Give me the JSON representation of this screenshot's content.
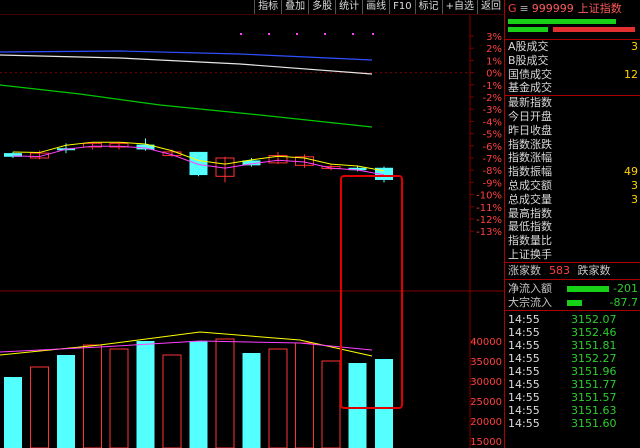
{
  "toolbar": [
    {
      "label": "指标",
      "name": "toolbar-indicator-button"
    },
    {
      "label": "叠加",
      "name": "toolbar-overlay-button"
    },
    {
      "label": "多股",
      "name": "toolbar-multistock-button"
    },
    {
      "label": "统计",
      "name": "toolbar-statistics-button"
    },
    {
      "label": "画线",
      "name": "toolbar-drawline-button"
    },
    {
      "label": "F10",
      "name": "toolbar-f10-button"
    },
    {
      "label": "标记",
      "name": "toolbar-mark-button"
    },
    {
      "label": "+自选",
      "name": "toolbar-add-watchlist-button"
    },
    {
      "label": "返回",
      "name": "toolbar-back-button"
    }
  ],
  "header": {
    "group": "G",
    "eq": "≡",
    "code": "999999",
    "name": "上证指数"
  },
  "colors": {
    "up": "#ff3232",
    "down": "#54ffff",
    "ma_white": "#e6e6e6",
    "ma_yellow": "#ffff00",
    "ma_magenta": "#ff40ff",
    "ma_green": "#00c800",
    "grid": "#800000",
    "highlight": "#e00000"
  },
  "price_axis": [
    "3%",
    "2%",
    "1%",
    "0%",
    "-1%",
    "-2%",
    "-3%",
    "-4%",
    "-5%",
    "-6%",
    "-7%",
    "-8%",
    "-9%",
    "-10%",
    "-11%",
    "-12%",
    "-13%"
  ],
  "volume_axis": [
    "40000",
    "35000",
    "30000",
    "25000",
    "20000",
    "15000"
  ],
  "section1": [
    {
      "label": "A股成交",
      "value": "3"
    },
    {
      "label": "B股成交",
      "value": ""
    },
    {
      "label": "国债成交",
      "value": "12"
    },
    {
      "label": "基金成交",
      "value": ""
    }
  ],
  "section2": [
    {
      "label": "最新指数",
      "value": ""
    },
    {
      "label": "今日开盘",
      "value": ""
    },
    {
      "label": "昨日收盘",
      "value": ""
    },
    {
      "label": "指数涨跌",
      "value": ""
    },
    {
      "label": "指数涨幅",
      "value": ""
    },
    {
      "label": "指数振幅",
      "value": "49"
    },
    {
      "label": "总成交额",
      "value": "3"
    },
    {
      "label": "总成交量",
      "value": "3"
    },
    {
      "label": "最高指数",
      "value": ""
    },
    {
      "label": "最低指数",
      "value": ""
    },
    {
      "label": "指数量比",
      "value": ""
    },
    {
      "label": "上证换手",
      "value": ""
    }
  ],
  "stats": {
    "rise_label": "涨家数",
    "rise_count": "583",
    "fall_label": "跌家数"
  },
  "flows": [
    {
      "label": "净流入额",
      "value": "-201",
      "bar": 0.6
    },
    {
      "label": "大宗流入",
      "value": "-87.7",
      "bar": 0.22
    }
  ],
  "ticks": [
    {
      "time": "14:55",
      "price": "3152.07",
      "vol": ""
    },
    {
      "time": "14:55",
      "price": "3152.46",
      "vol": ""
    },
    {
      "time": "14:55",
      "price": "3151.81",
      "vol": ""
    },
    {
      "time": "14:55",
      "price": "3152.27",
      "vol": ""
    },
    {
      "time": "14:55",
      "price": "3151.96",
      "vol": ""
    },
    {
      "time": "14:55",
      "price": "3151.77",
      "vol": ""
    },
    {
      "time": "14:55",
      "price": "3151.57",
      "vol": ""
    },
    {
      "time": "14:55",
      "price": "3151.63",
      "vol": ""
    },
    {
      "time": "14:55",
      "price": "3151.60",
      "vol": ""
    }
  ],
  "candles": [
    {
      "o": -6.6,
      "c": -6.9,
      "h": -6.5,
      "l": -7.0,
      "v": 31000,
      "up": false
    },
    {
      "o": -6.6,
      "c": -7.0,
      "h": -6.4,
      "l": -7.1,
      "v": 33500,
      "up": true
    },
    {
      "o": -6.2,
      "c": -6.2,
      "h": -5.8,
      "l": -6.6,
      "v": 36500,
      "up": false
    },
    {
      "o": -6.1,
      "c": -5.8,
      "h": -5.7,
      "l": -6.3,
      "v": 39000,
      "up": true
    },
    {
      "o": -6.1,
      "c": -5.8,
      "h": -5.7,
      "l": -6.3,
      "v": 38000,
      "up": true
    },
    {
      "o": -5.9,
      "c": -6.3,
      "h": -5.4,
      "l": -6.4,
      "v": 40000,
      "up": false
    },
    {
      "o": -6.8,
      "c": -6.5,
      "h": -6.3,
      "l": -6.9,
      "v": 36500,
      "up": true
    },
    {
      "o": -6.5,
      "c": -8.4,
      "h": -6.5,
      "l": -8.5,
      "v": 40000,
      "up": false
    },
    {
      "o": -7.0,
      "c": -8.5,
      "h": -6.9,
      "l": -9.0,
      "v": 40500,
      "up": true
    },
    {
      "o": -7.6,
      "c": -7.2,
      "h": -7.0,
      "l": -7.7,
      "v": 37000,
      "up": false
    },
    {
      "o": -6.8,
      "c": -7.4,
      "h": -6.5,
      "l": -7.5,
      "v": 38000,
      "up": true
    },
    {
      "o": -6.9,
      "c": -7.6,
      "h": -6.7,
      "l": -7.8,
      "v": 39500,
      "up": true
    },
    {
      "o": -7.8,
      "c": -7.7,
      "h": -7.5,
      "l": -8.0,
      "v": 35000,
      "up": true
    },
    {
      "o": -7.8,
      "c": -8.0,
      "h": -7.6,
      "l": -8.1,
      "v": 34500,
      "up": false
    },
    {
      "o": -7.8,
      "c": -8.8,
      "h": -7.7,
      "l": -9.0,
      "v": 35500,
      "up": false
    }
  ]
}
